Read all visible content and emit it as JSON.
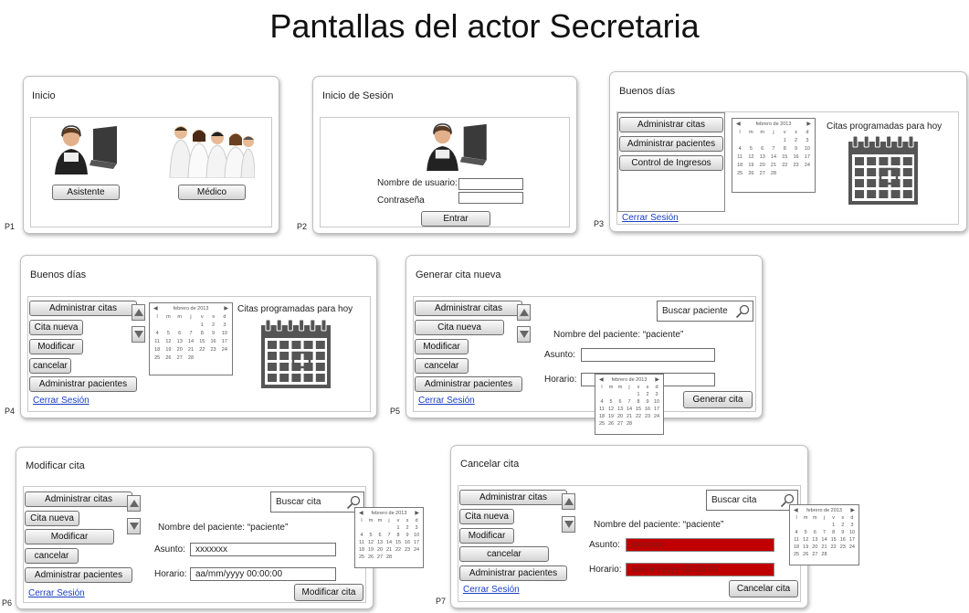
{
  "page_title": "Pantallas del actor Secretaria",
  "calendar": {
    "month": "febrero de 2013",
    "weekdays": [
      "l",
      "m",
      "m",
      "j",
      "v",
      "s",
      "d"
    ],
    "cells": [
      "",
      "",
      "",
      "",
      "1",
      "2",
      "3",
      "4",
      "5",
      "6",
      "7",
      "8",
      "9",
      "10",
      "11",
      "12",
      "13",
      "14",
      "15",
      "16",
      "17",
      "18",
      "19",
      "20",
      "21",
      "22",
      "23",
      "24",
      "25",
      "26",
      "27",
      "28",
      "",
      "",
      ""
    ]
  },
  "screens": {
    "p1": {
      "label": "P1",
      "title": "Inicio",
      "btn_asistente": "Asistente",
      "btn_medico": "Médico"
    },
    "p2": {
      "label": "P2",
      "title": "Inicio de Sesión",
      "usuario_label": "Nombre de usuario:",
      "password_label": "Contraseña",
      "btn_entrar": "Entrar"
    },
    "p3": {
      "label": "P3",
      "title": "Buenos días",
      "menu": [
        "Administrar citas",
        "Administrar pacientes",
        "Control de Ingresos"
      ],
      "citas_hoy": "Citas programadas para hoy",
      "logout": "Cerrar Sesión"
    },
    "p4": {
      "label": "P4",
      "title": "Buenos días",
      "menu": [
        "Administrar citas",
        "Cita nueva",
        "Modificar",
        "cancelar",
        "Administrar pacientes"
      ],
      "citas_hoy": "Citas programadas para hoy",
      "logout": "Cerrar Sesión"
    },
    "p5": {
      "label": "P5",
      "title": "Generar cita nueva",
      "menu": [
        "Administrar citas",
        "Cita nueva",
        "Modificar",
        "cancelar",
        "Administrar pacientes"
      ],
      "search": "Buscar paciente",
      "paciente": "Nombre del paciente: “paciente”",
      "asunto_label": "Asunto:",
      "horario_label": "Horario:",
      "btn_generar": "Generar cita",
      "logout": "Cerrar Sesión"
    },
    "p6": {
      "label": "P6",
      "title": "Modificar cita",
      "menu": [
        "Administrar citas",
        "Cita nueva",
        "Modificar",
        "cancelar",
        "Administrar pacientes"
      ],
      "search": "Buscar cita",
      "paciente": "Nombre del paciente: “paciente”",
      "asunto_label": "Asunto:",
      "asunto_value": "xxxxxxx",
      "horario_label": "Horario:",
      "horario_value": "aa/mm/yyyy 00:00:00",
      "btn_modificar": "Modificar cita",
      "logout": "Cerrar Sesión"
    },
    "p7": {
      "label": "P7",
      "title": "Cancelar cita",
      "menu": [
        "Administrar citas",
        "Cita nueva",
        "Modificar",
        "cancelar",
        "Administrar pacientes"
      ],
      "search": "Buscar cita",
      "paciente": "Nombre del paciente: “paciente”",
      "asunto_label": "Asunto:",
      "asunto_value": "xxxxxxx",
      "horario_label": "Horario:",
      "horario_value": "aa/mm/yyyy 00:00:00",
      "btn_cancelar": "Cancelar cita",
      "logout": "Cerrar Sesión"
    }
  },
  "colors": {
    "link": "#1a3fc4",
    "error_field": "#c00000",
    "calendar_icon": "#555555"
  }
}
